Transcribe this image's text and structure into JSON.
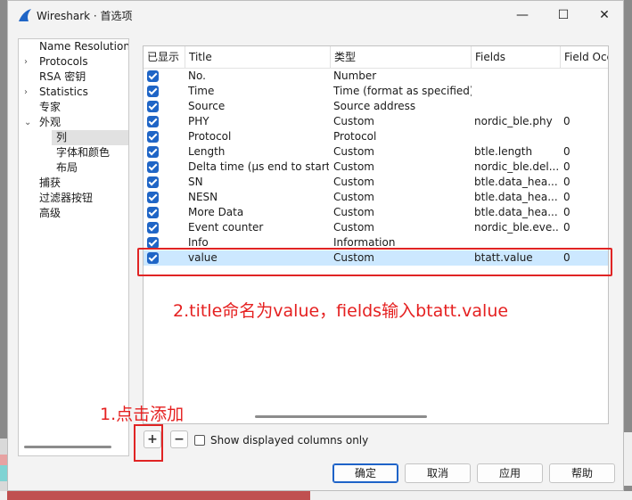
{
  "window": {
    "title": "Wireshark · 首选项",
    "min_glyph": "—",
    "max_glyph": "☐",
    "close_glyph": "✕"
  },
  "tree": {
    "items": [
      {
        "label": "Name Resolution",
        "arrow": ""
      },
      {
        "label": "Protocols",
        "arrow": "›"
      },
      {
        "label": "RSA 密钥",
        "arrow": ""
      },
      {
        "label": "Statistics",
        "arrow": "›"
      },
      {
        "label": "专家",
        "arrow": ""
      },
      {
        "label": "外观",
        "arrow": "⌄"
      },
      {
        "label": "列",
        "arrow": ""
      },
      {
        "label": "字体和颜色",
        "arrow": ""
      },
      {
        "label": "布局",
        "arrow": ""
      },
      {
        "label": "捕获",
        "arrow": ""
      },
      {
        "label": "过滤器按钮",
        "arrow": ""
      },
      {
        "label": "高级",
        "arrow": ""
      }
    ],
    "selected": "列"
  },
  "table": {
    "headers": [
      "已显示",
      "Title",
      "类型",
      "Fields",
      "Field Occ"
    ],
    "rows": [
      {
        "title": "No.",
        "type": "Number",
        "fields": "",
        "occ": ""
      },
      {
        "title": "Time",
        "type": "Time (format as specified)",
        "fields": "",
        "occ": ""
      },
      {
        "title": "Source",
        "type": "Source address",
        "fields": "",
        "occ": ""
      },
      {
        "title": "PHY",
        "type": "Custom",
        "fields": "nordic_ble.phy",
        "occ": "0"
      },
      {
        "title": "Protocol",
        "type": "Protocol",
        "fields": "",
        "occ": ""
      },
      {
        "title": "Length",
        "type": "Custom",
        "fields": "btle.length",
        "occ": "0"
      },
      {
        "title": "Delta time (µs end to start)",
        "type": "Custom",
        "fields": "nordic_ble.del...",
        "occ": "0"
      },
      {
        "title": "SN",
        "type": "Custom",
        "fields": "btle.data_hea...",
        "occ": "0"
      },
      {
        "title": "NESN",
        "type": "Custom",
        "fields": "btle.data_hea...",
        "occ": "0"
      },
      {
        "title": "More Data",
        "type": "Custom",
        "fields": "btle.data_hea...",
        "occ": "0"
      },
      {
        "title": "Event counter",
        "type": "Custom",
        "fields": "nordic_ble.eve...",
        "occ": "0"
      },
      {
        "title": "Info",
        "type": "Information",
        "fields": "",
        "occ": ""
      },
      {
        "title": "value",
        "type": "Custom",
        "fields": "btatt.value",
        "occ": "0"
      }
    ],
    "selected_row": "value"
  },
  "annotations": {
    "step1": "1.点击添加",
    "step2": "2.title命名为value，fields输入btatt.value",
    "color": "#e52020"
  },
  "controls": {
    "add_glyph": "+",
    "remove_glyph": "−",
    "show_displayed_label": "Show displayed columns only"
  },
  "buttons": {
    "ok": "确定",
    "cancel": "取消",
    "apply": "应用",
    "help": "帮助"
  },
  "colors": {
    "accent": "#1f65c6",
    "selection": "#cce8ff"
  }
}
